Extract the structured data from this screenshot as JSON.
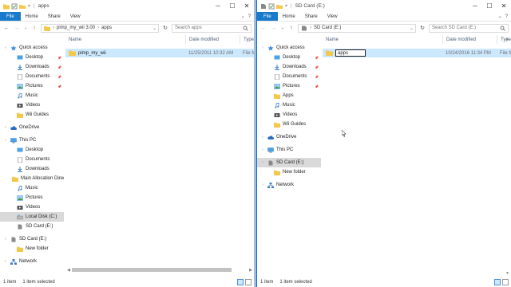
{
  "left": {
    "title": "apps",
    "tabs": {
      "file": "File",
      "home": "Home",
      "share": "Share",
      "view": "View"
    },
    "breadcrumb": [
      "pimp_my_wii 3.00",
      "apps"
    ],
    "search_placeholder": "Search apps",
    "columns": {
      "name": "Name",
      "date": "Date modified",
      "type": "Type"
    },
    "files": [
      {
        "name": "pimp_my_wii",
        "date": "11/25/2011 10:32 AM",
        "type": "File fo"
      }
    ],
    "nav": [
      {
        "label": "Quick access",
        "icon": "star-icon"
      },
      {
        "label": "Desktop",
        "icon": "desktop-icon",
        "pin": true
      },
      {
        "label": "Downloads",
        "icon": "download-icon",
        "pin": true
      },
      {
        "label": "Documents",
        "icon": "documents-icon",
        "pin": true
      },
      {
        "label": "Pictures",
        "icon": "pictures-icon",
        "pin": true
      },
      {
        "label": "Music",
        "icon": "music-icon"
      },
      {
        "label": "Videos",
        "icon": "videos-icon"
      },
      {
        "label": "Wii Guides",
        "icon": "folder-icon"
      },
      {
        "label": "OneDrive",
        "icon": "cloud-icon"
      },
      {
        "label": "This PC",
        "icon": "computer-icon"
      },
      {
        "label": "Desktop",
        "icon": "desktop-icon"
      },
      {
        "label": "Documents",
        "icon": "documents-icon"
      },
      {
        "label": "Downloads",
        "icon": "download-icon"
      },
      {
        "label": "Main Allocation Directory",
        "icon": "folder-icon"
      },
      {
        "label": "Music",
        "icon": "music-icon"
      },
      {
        "label": "Pictures",
        "icon": "pictures-icon"
      },
      {
        "label": "Videos",
        "icon": "videos-icon"
      },
      {
        "label": "Local Disk (C:)",
        "icon": "drive-icon",
        "selected": true
      },
      {
        "label": "SD Card (E:)",
        "icon": "sdcard-icon"
      },
      {
        "label": "SD Card (E:)",
        "icon": "sdcard-icon"
      },
      {
        "label": "New folder",
        "icon": "folder-icon"
      },
      {
        "label": "Network",
        "icon": "network-icon"
      }
    ],
    "status": {
      "count": "1 item",
      "selected": "1 item selected"
    }
  },
  "right": {
    "title": "SD Card (E:)",
    "tabs": {
      "file": "File",
      "home": "Home",
      "share": "Share",
      "view": "View"
    },
    "breadcrumb": [
      "SD Card (E:)"
    ],
    "search_placeholder": "Search SD Card (E:)",
    "columns": {
      "name": "Name",
      "date": "Date modified",
      "type": "Type"
    },
    "files": [
      {
        "name": "apps",
        "date": "10/24/2016 11:34 PM",
        "type": "File fo"
      }
    ],
    "nav": [
      {
        "label": "Quick access",
        "icon": "star-icon"
      },
      {
        "label": "Desktop",
        "icon": "desktop-icon",
        "pin": true
      },
      {
        "label": "Downloads",
        "icon": "download-icon",
        "pin": true
      },
      {
        "label": "Documents",
        "icon": "documents-icon",
        "pin": true
      },
      {
        "label": "Pictures",
        "icon": "pictures-icon",
        "pin": true
      },
      {
        "label": "Apps",
        "icon": "folder-icon"
      },
      {
        "label": "Music",
        "icon": "music-icon"
      },
      {
        "label": "Videos",
        "icon": "videos-icon"
      },
      {
        "label": "Wii Guides",
        "icon": "folder-icon"
      },
      {
        "label": "OneDrive",
        "icon": "cloud-icon"
      },
      {
        "label": "This PC",
        "icon": "computer-icon"
      },
      {
        "label": "SD Card (E:)",
        "icon": "sdcard-icon",
        "selected": true
      },
      {
        "label": "New folder",
        "icon": "folder-icon"
      },
      {
        "label": "Network",
        "icon": "network-icon"
      }
    ],
    "status": {
      "count": "1 item",
      "selected": "1 item selected"
    }
  },
  "colors": {
    "accent": "#1979ca",
    "selection": "#cce8ff",
    "nav_selected": "#d9d9d9",
    "folder": "#f4c84a"
  }
}
